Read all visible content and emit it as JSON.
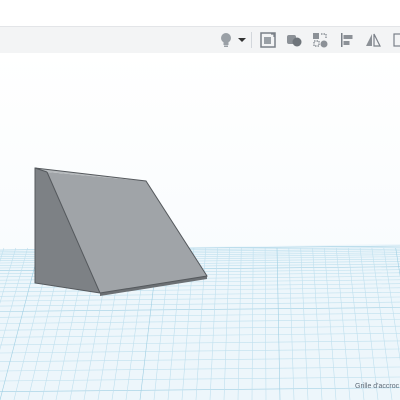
{
  "toolbar": {
    "buttons": [
      {
        "name": "bulb-icon"
      },
      {
        "name": "dropdown-arrow-icon"
      },
      {
        "name": "show-all-icon"
      },
      {
        "name": "group-icon"
      },
      {
        "name": "ungroup-icon"
      },
      {
        "name": "align-icon"
      },
      {
        "name": "mirror-icon"
      },
      {
        "name": "more-icon"
      }
    ]
  },
  "workplane": {
    "grid_label": "Grille d'accroc"
  },
  "colors": {
    "toolbar_bg": "#f3f4f5",
    "grid_line": "#c9e6f2",
    "shape_front": "#9b9fa3",
    "shape_side": "#7e8286"
  }
}
